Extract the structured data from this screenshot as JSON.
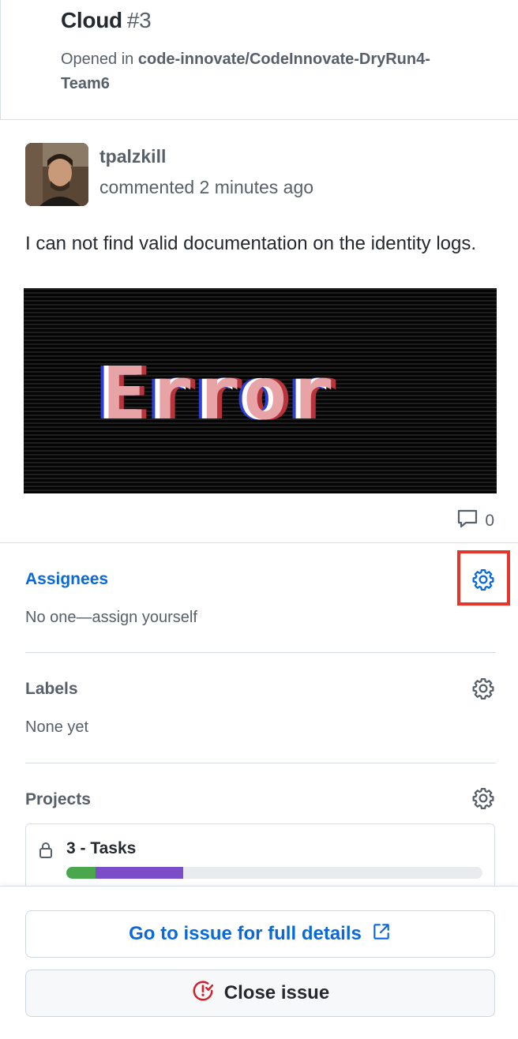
{
  "issue": {
    "title": "Cloud",
    "number": "#3",
    "opened_prefix": "Opened in",
    "repo": "code-innovate/CodeInnovate-DryRun4-Team6"
  },
  "comment": {
    "author": "tpalzkill",
    "meta": "commented 2 minutes ago",
    "body": "I can not find valid documentation on the identity logs.",
    "image_text": "Error",
    "reply_count": "0"
  },
  "sidebar": {
    "assignees": {
      "title": "Assignees",
      "value": "No one—assign yourself"
    },
    "labels": {
      "title": "Labels",
      "value": "None yet"
    },
    "projects": {
      "title": "Projects",
      "card": {
        "name": "3 - Tasks",
        "progress_done_fraction": 0.07,
        "progress_in_progress_fraction": 0.21
      }
    }
  },
  "footer": {
    "details_label": "Go to issue for full details",
    "close_label": "Close issue"
  },
  "colors": {
    "link_blue": "#0969da",
    "highlight_red": "#e4362b",
    "progress_green": "#4aa74e",
    "progress_purple": "#7c4dc9",
    "close_icon_red": "#cf222e"
  }
}
